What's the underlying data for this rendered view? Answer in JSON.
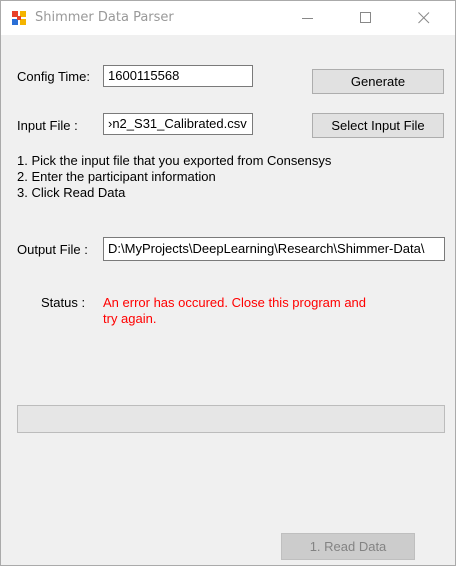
{
  "window": {
    "title": "Shimmer Data Parser"
  },
  "config": {
    "label": "Config Time:",
    "value": "1600115568",
    "generate_label": "Generate"
  },
  "input": {
    "label": "Input File :",
    "value": "›n2_S31_Calibrated.csv",
    "select_label": "Select Input File"
  },
  "instructions": [
    "1. Pick the input file that you exported from Consensys",
    "2. Enter the participant information",
    "3. Click Read Data"
  ],
  "output": {
    "label": "Output File :",
    "value": "D:\\MyProjects\\DeepLearning\\Research\\Shimmer-Data\\"
  },
  "status": {
    "label": "Status :",
    "message": "An error has occured. Close this program and try again.",
    "color": "#ff0000"
  },
  "progress": {
    "value": 0
  },
  "read_button": {
    "label": "1. Read Data",
    "enabled": false
  },
  "icons": [
    "app-icon",
    "minimize-icon",
    "maximize-icon",
    "close-icon"
  ]
}
